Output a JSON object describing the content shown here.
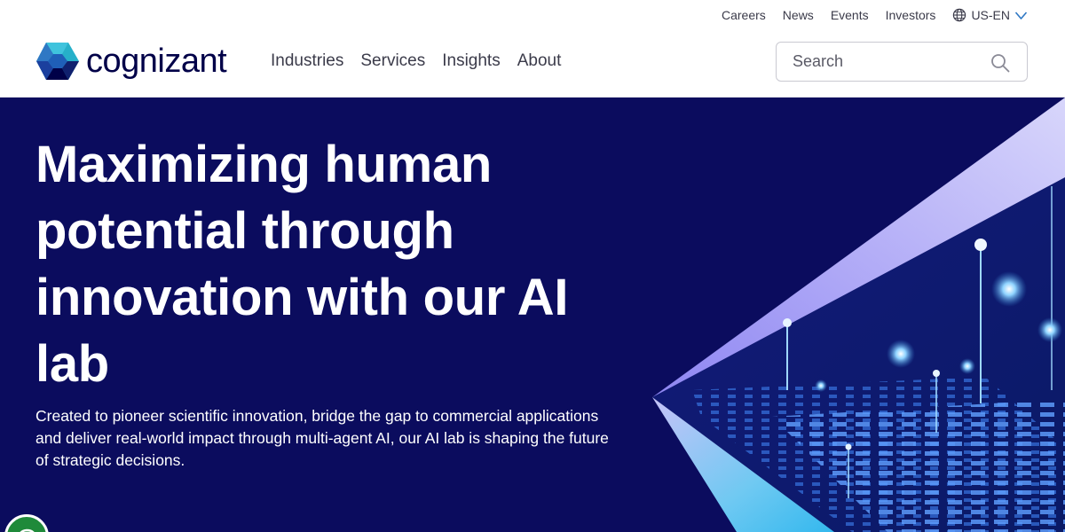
{
  "utility_nav": {
    "items": [
      "Careers",
      "News",
      "Events",
      "Investors"
    ],
    "locale": "US-EN"
  },
  "brand": {
    "name": "cognizant",
    "colors": {
      "navy": "#000048",
      "blue": "#2f78c4",
      "teal": "#26b0c9"
    }
  },
  "main_nav": {
    "items": [
      "Industries",
      "Services",
      "Insights",
      "About"
    ]
  },
  "search": {
    "placeholder": "Search",
    "icon": "search-icon"
  },
  "hero": {
    "title": "Maximizing human potential through innovation with our AI lab",
    "description": "Created to pioneer scientific innovation, bridge the gap to commercial applications and deliver real-world impact through multi-agent AI, our AI lab is shaping the future of strategic decisions.",
    "background_color": "#0b0c5e"
  },
  "chat": {
    "icon": "chat-icon",
    "color": "#1f8a3a"
  }
}
